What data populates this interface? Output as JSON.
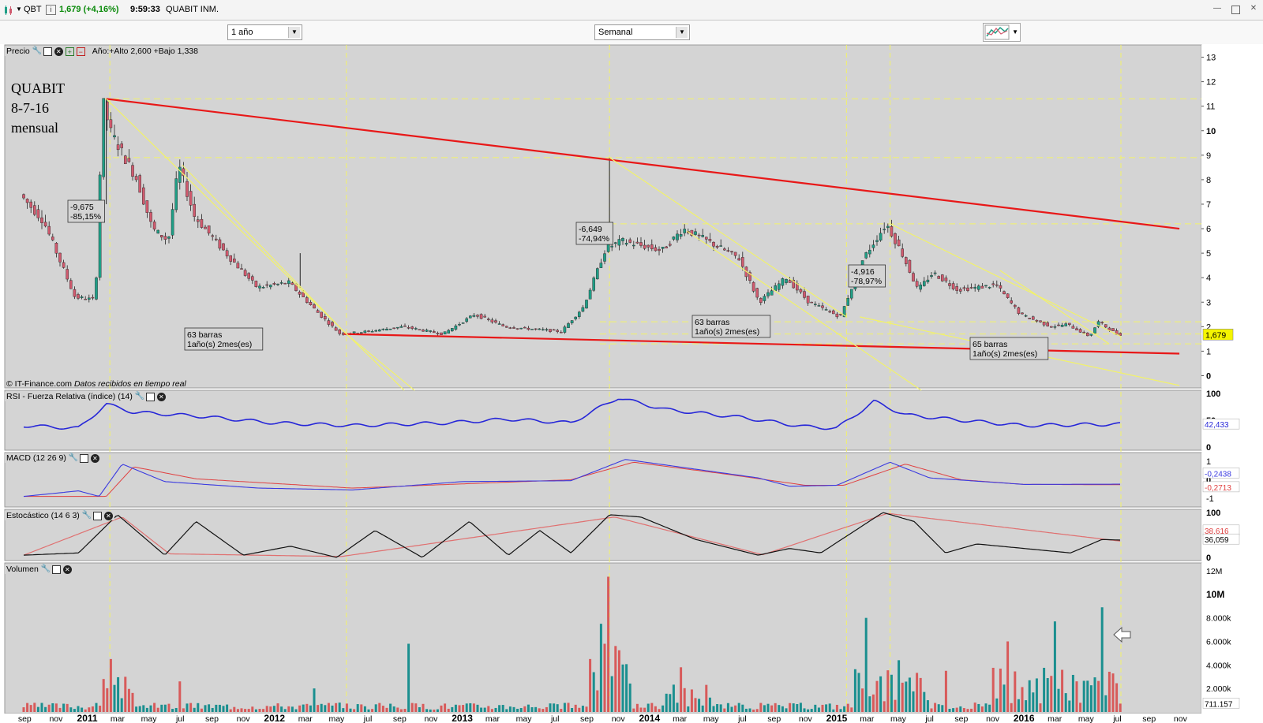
{
  "header": {
    "symbol": "QBT",
    "info_icon": "i",
    "quote": "1,679 (+4,16%)",
    "time": "9:59:33",
    "name": "QUABIT INM."
  },
  "toolbar": {
    "range_select": "1 año",
    "interval_select": "Semanal",
    "chart_type_icon": "candlestick-chart-icon"
  },
  "panels": {
    "price": {
      "label": "Precio",
      "range_text": "Año:+Alto 2,600 +Bajo 1,338"
    },
    "rsi": {
      "label": "RSI - Fuerza Relativa (índice) (14)"
    },
    "macd": {
      "label": "MACD (12 26 9)"
    },
    "stoch": {
      "label": "Estocástico (14 6 3)"
    },
    "volume": {
      "label": "Volumen"
    }
  },
  "annotations": {
    "note_lines": [
      "QUABIT",
      "8-7-16",
      "mensual"
    ],
    "credit": "© IT-Finance.com",
    "credit_tail": "Datos recibidos en tiempo real",
    "drop_labels": [
      {
        "lines": [
          "-9,675",
          "-85,15%"
        ]
      },
      {
        "lines": [
          "-6,649",
          "-74,94%"
        ]
      },
      {
        "lines": [
          "-4,916",
          "-78,97%"
        ]
      }
    ],
    "bar_count_labels": [
      {
        "lines": [
          "63 barras",
          "1año(s) 2mes(es)"
        ]
      },
      {
        "lines": [
          "63 barras",
          "1año(s) 2mes(es)"
        ]
      },
      {
        "lines": [
          "65 barras",
          "1año(s) 2mes(es)"
        ]
      }
    ]
  },
  "colors": {
    "panel_bg": "#d4d4d4",
    "up_candle": "#1f9e86",
    "down_candle": "#d05a6e",
    "trend_red": "#e81818",
    "trend_yellow": "#f2f26a",
    "rsi_line": "#2626d8",
    "macd_line": "#3a3ae0",
    "signal_line": "#e04040",
    "stoch_k": "#111111",
    "stoch_d": "#e07070",
    "vol_up": "#1a8f8f",
    "vol_down": "#d85a5a",
    "last_price_bg": "#f5f500"
  },
  "chart_data": [
    {
      "type": "line",
      "title": "Precio",
      "x_axis": {
        "dates": [
          "2010-08-30",
          "2014-08-10",
          "2016-07-08"
        ],
        "tick_labels": [
          "sep",
          "nov",
          "2011",
          "mar",
          "may",
          "jul",
          "sep",
          "nov",
          "2012",
          "mar",
          "may",
          "jul",
          "sep",
          "nov",
          "2013",
          "mar",
          "may",
          "jul",
          "sep",
          "nov",
          "2014",
          "mar",
          "may",
          "jul",
          "sep",
          "nov",
          "2015",
          "mar",
          "may",
          "jul",
          "sep",
          "nov",
          "2016",
          "mar",
          "may",
          "jul",
          "sep",
          "nov"
        ]
      },
      "y_axis": {
        "ylim": [
          -0.5,
          13.5
        ],
        "tick_labels": [
          "13",
          "12",
          "11",
          "10",
          "9",
          "8",
          "7",
          "6",
          "5",
          "4",
          "3",
          "2",
          "1",
          "0"
        ]
      },
      "last_value": "1,679",
      "series": [
        {
          "points": [
            [
              "2010-08-30",
              7.4
            ],
            [
              "2010-10-15",
              6.3
            ],
            [
              "2010-12-15",
              3.2
            ],
            [
              "2011-01-24",
              3.1
            ],
            [
              "2011-02-07",
              11.3
            ],
            [
              "2011-02-21",
              10
            ],
            [
              "2011-04-15",
              8
            ],
            [
              "2011-05-15",
              6
            ],
            [
              "2011-06-15",
              5.5
            ],
            [
              "2011-07-05",
              8.6
            ],
            [
              "2011-08-05",
              6.5
            ],
            [
              "2011-10-05",
              5
            ],
            [
              "2011-12-05",
              3.6
            ],
            [
              "2012-02-05",
              3.8
            ],
            [
              "2012-04-05",
              2.5
            ],
            [
              "2012-05-15",
              1.7
            ],
            [
              "2012-07-05",
              1.8
            ],
            [
              "2012-09-15",
              2
            ],
            [
              "2012-12-01",
              1.7
            ],
            [
              "2013-02-01",
              2.5
            ],
            [
              "2013-04-01",
              2
            ],
            [
              "2013-07-20",
              1.8
            ],
            [
              "2013-09-01",
              2.8
            ],
            [
              "2013-10-15",
              5.2
            ],
            [
              "2013-11-15",
              5.5
            ],
            [
              "2014-02-01",
              5.1
            ],
            [
              "2014-03-15",
              6
            ],
            [
              "2014-05-01",
              5.5
            ],
            [
              "2014-07-01",
              4.8
            ],
            [
              "2014-08-10",
              3
            ],
            [
              "2014-10-01",
              4
            ],
            [
              "2014-11-15",
              3
            ],
            [
              "2015-01-15",
              2.4
            ],
            [
              "2015-03-01",
              4.8
            ],
            [
              "2015-04-15",
              6.2
            ],
            [
              "2015-05-15",
              5
            ],
            [
              "2015-06-15",
              3.5
            ],
            [
              "2015-07-15",
              4.2
            ],
            [
              "2015-09-01",
              3.5
            ],
            [
              "2015-11-15",
              3.7
            ],
            [
              "2016-01-01",
              2.5
            ],
            [
              "2016-03-01",
              2
            ],
            [
              "2016-04-01",
              2.1
            ],
            [
              "2016-05-15",
              1.6
            ],
            [
              "2016-06-01",
              2.2
            ],
            [
              "2016-07-08",
              1.68
            ]
          ]
        }
      ],
      "trendlines": [
        {
          "color": "red",
          "from": [
            "2011-02-07",
            11.3
          ],
          "to": [
            "2016-10-30",
            6.0
          ]
        },
        {
          "color": "red",
          "from": [
            "2012-05-15",
            1.7
          ],
          "to": [
            "2016-10-30",
            0.9
          ]
        }
      ]
    },
    {
      "type": "line",
      "title": "RSI - Fuerza Relativa (índice) (14)",
      "ylim": [
        0,
        100
      ],
      "tick_labels": [
        "100",
        "50",
        "0"
      ],
      "last_value": "42,433",
      "series": [
        {
          "name": "RSI",
          "points": [
            [
              "2010-08-30",
              40
            ],
            [
              "2010-12-15",
              35
            ],
            [
              "2011-02-07",
              80
            ],
            [
              "2011-04-01",
              65
            ],
            [
              "2011-08-01",
              58
            ],
            [
              "2012-01-01",
              45
            ],
            [
              "2012-06-01",
              40
            ],
            [
              "2012-12-01",
              45
            ],
            [
              "2013-04-01",
              52
            ],
            [
              "2013-08-01",
              45
            ],
            [
              "2013-11-01",
              92
            ],
            [
              "2014-02-01",
              70
            ],
            [
              "2014-07-01",
              55
            ],
            [
              "2014-11-01",
              38
            ],
            [
              "2015-01-01",
              35
            ],
            [
              "2015-03-15",
              85
            ],
            [
              "2015-05-15",
              60
            ],
            [
              "2015-09-01",
              50
            ],
            [
              "2016-01-01",
              40
            ],
            [
              "2016-05-01",
              42
            ],
            [
              "2016-07-08",
              42.4
            ]
          ]
        }
      ]
    },
    {
      "type": "line",
      "title": "MACD (12 26 9)",
      "ylim": [
        -1.3,
        1.3
      ],
      "tick_labels": [
        "1",
        "0",
        "-1"
      ],
      "last_values": [
        "-0,2438",
        "-0,2713"
      ],
      "series": [
        {
          "name": "MACD",
          "points": [
            [
              "2010-08-30",
              -0.9
            ],
            [
              "2010-12-15",
              -0.6
            ],
            [
              "2011-01-24",
              -0.9
            ],
            [
              "2011-03-10",
              0.85
            ],
            [
              "2011-06-01",
              -0.1
            ],
            [
              "2011-12-01",
              -0.45
            ],
            [
              "2012-06-01",
              -0.55
            ],
            [
              "2013-01-01",
              -0.1
            ],
            [
              "2013-08-01",
              -0.05
            ],
            [
              "2013-11-15",
              1.1
            ],
            [
              "2014-02-01",
              0.8
            ],
            [
              "2014-08-01",
              0.1
            ],
            [
              "2014-10-01",
              -0.35
            ],
            [
              "2015-01-01",
              -0.3
            ],
            [
              "2015-04-15",
              0.95
            ],
            [
              "2015-07-01",
              0.1
            ],
            [
              "2016-01-01",
              -0.25
            ],
            [
              "2016-07-08",
              -0.24
            ]
          ]
        },
        {
          "name": "Signal",
          "points": [
            [
              "2010-08-30",
              -0.9
            ],
            [
              "2011-02-07",
              -0.9
            ],
            [
              "2011-04-01",
              0.7
            ],
            [
              "2011-08-01",
              0.05
            ],
            [
              "2012-06-01",
              -0.45
            ],
            [
              "2013-08-01",
              0
            ],
            [
              "2013-12-01",
              0.95
            ],
            [
              "2014-06-01",
              0.3
            ],
            [
              "2014-11-01",
              -0.3
            ],
            [
              "2015-01-15",
              -0.3
            ],
            [
              "2015-05-15",
              0.85
            ],
            [
              "2015-09-01",
              0
            ],
            [
              "2016-01-01",
              -0.25
            ],
            [
              "2016-07-08",
              -0.27
            ]
          ]
        }
      ]
    },
    {
      "type": "line",
      "title": "Estocástico (14 6 3)",
      "ylim": [
        0,
        100
      ],
      "tick_labels": [
        "100",
        "50",
        "0"
      ],
      "last_values": [
        "38,616",
        "36,059"
      ],
      "series": [
        {
          "name": "%K",
          "points": [
            [
              "2010-08-30",
              5
            ],
            [
              "2010-12-15",
              10
            ],
            [
              "2011-03-01",
              95
            ],
            [
              "2011-06-01",
              5
            ],
            [
              "2011-08-01",
              80
            ],
            [
              "2011-11-01",
              5
            ],
            [
              "2012-02-01",
              25
            ],
            [
              "2012-05-01",
              0
            ],
            [
              "2012-07-15",
              60
            ],
            [
              "2012-10-15",
              0
            ],
            [
              "2013-01-15",
              80
            ],
            [
              "2013-04-01",
              5
            ],
            [
              "2013-06-01",
              60
            ],
            [
              "2013-08-01",
              10
            ],
            [
              "2013-10-15",
              95
            ],
            [
              "2013-12-15",
              90
            ],
            [
              "2014-04-01",
              40
            ],
            [
              "2014-08-01",
              5
            ],
            [
              "2014-10-01",
              20
            ],
            [
              "2014-12-01",
              10
            ],
            [
              "2015-04-01",
              100
            ],
            [
              "2015-06-01",
              80
            ],
            [
              "2015-08-01",
              10
            ],
            [
              "2015-10-01",
              30
            ],
            [
              "2016-01-01",
              20
            ],
            [
              "2016-04-01",
              10
            ],
            [
              "2016-06-01",
              40
            ],
            [
              "2016-07-08",
              38.6
            ]
          ]
        },
        {
          "name": "%D",
          "points": [
            [
              "2010-08-30",
              5
            ],
            [
              "2011-03-10",
              90
            ],
            [
              "2011-06-10",
              8
            ],
            [
              "2012-05-10",
              2
            ],
            [
              "2013-10-25",
              90
            ],
            [
              "2014-08-10",
              6
            ],
            [
              "2015-04-10",
              98
            ],
            [
              "2016-07-08",
              36.1
            ]
          ]
        }
      ]
    },
    {
      "type": "bar",
      "title": "Volumen",
      "ylim": [
        0,
        12000000
      ],
      "tick_labels": [
        "12M",
        "10M",
        "8.000k",
        "6.000k",
        "4.000k",
        "2.000k"
      ],
      "last_value": "711.157",
      "values_note_bars": [
        [
          "2011-02-14",
          4500000
        ],
        [
          "2011-07-01",
          2600000
        ],
        [
          "2012-03-15",
          2000000
        ],
        [
          "2012-09-15",
          5800000
        ],
        [
          "2013-10-15",
          11500000
        ],
        [
          "2013-10-01",
          7500000
        ],
        [
          "2014-03-01",
          3800000
        ],
        [
          "2015-03-01",
          8000000
        ],
        [
          "2015-05-01",
          4400000
        ],
        [
          "2015-08-01",
          3500000
        ],
        [
          "2015-12-01",
          6000000
        ],
        [
          "2016-03-01",
          7700000
        ],
        [
          "2016-06-01",
          8900000
        ],
        [
          "2016-07-08",
          711157
        ]
      ]
    }
  ]
}
